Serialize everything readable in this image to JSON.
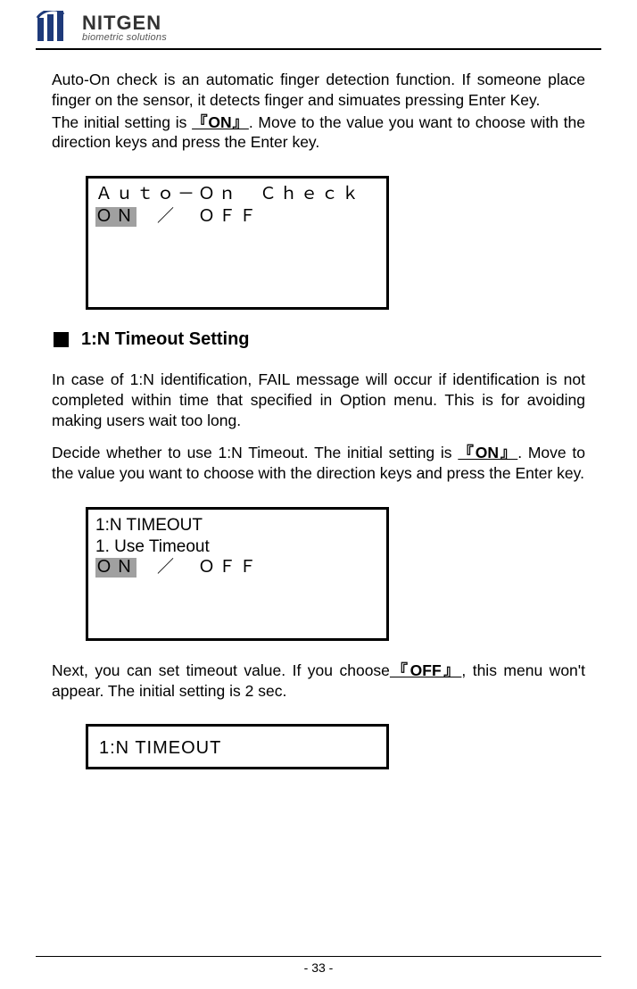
{
  "brand": {
    "main": "NITGEN",
    "sub": "biometric solutions"
  },
  "para1": "Auto-On check is an automatic finger detection function. If someone place finger on the sensor, it detects finger and simuates pressing Enter Key.",
  "para2a": "The initial setting is ",
  "para2_on": "『ON』",
  "para2b": ". Move to the value you want to choose with the direction keys and press the Enter key.",
  "box1": {
    "line1": "Ａｕｔｏ－Ｏｎ　Ｃｈｅｃｋ",
    "on": "ＯＮ",
    "sep": "　／　ＯＦＦ"
  },
  "section": {
    "title": "1:N Timeout Setting"
  },
  "para3": "In case of 1:N identification, FAIL message will occur if identification is not completed within time that specified in Option menu. This is for avoiding making users wait too long.",
  "para4a": "Decide whether to use 1:N Timeout. The initial setting is ",
  "para4_on": "『ON』",
  "para4b": ". Move to the value you want to choose with the direction keys and press the Enter key.",
  "box2": {
    "line1": "1:N TIMEOUT",
    "line2": "1. Use Timeout",
    "on": "ＯＮ",
    "sep": "　／　ＯＦＦ"
  },
  "para5a": "Next, you can set timeout value. If you choose",
  "para5_off": "『OFF』",
  "para5b": ", this menu won't appear. The initial setting is 2 sec.",
  "box3": {
    "line1": "1:N TIMEOUT"
  },
  "pagenum": "- 33 -"
}
